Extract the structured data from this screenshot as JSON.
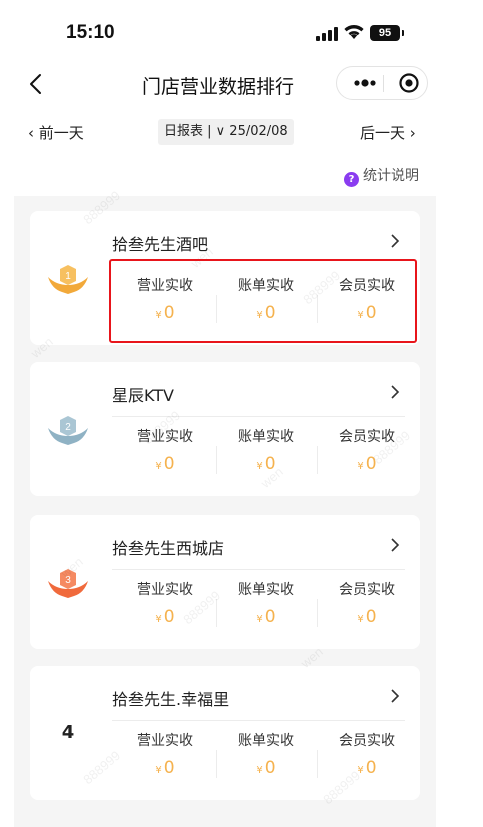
{
  "status_bar": {
    "time": "15:10",
    "battery": "95"
  },
  "nav": {
    "title": "门店营业数据排行"
  },
  "date_bar": {
    "prev": "‹ 前一天",
    "next": "后一天 ›",
    "period": "日报表 | ∨ 25/02/08"
  },
  "help": {
    "icon": "?",
    "label": "统计说明"
  },
  "metric_labels": [
    "营业实收",
    "账单实收",
    "会员实收"
  ],
  "currency_symbol": "¥",
  "colors": {
    "accent": "#8a3cf0",
    "value": "#f5b24e",
    "highlight": "#e8151b",
    "gold": "#f2a93a",
    "silver": "#8fb2c4",
    "bronze": "#f06a3c"
  },
  "stores": [
    {
      "rank": "1",
      "badge": "gold-medal-icon",
      "name": "拾叁先生酒吧",
      "values": [
        "0",
        "0",
        "0"
      ]
    },
    {
      "rank": "2",
      "badge": "silver-medal-icon",
      "name": "星辰KTV",
      "values": [
        "0",
        "0",
        "0"
      ]
    },
    {
      "rank": "3",
      "badge": "bronze-medal-icon",
      "name": "拾叁先生西城店",
      "values": [
        "0",
        "0",
        "0"
      ]
    },
    {
      "rank": "4",
      "badge": "",
      "name": "拾叁先生.幸福里",
      "values": [
        "0",
        "0",
        "0"
      ]
    }
  ],
  "watermark": [
    "888999",
    "wen"
  ]
}
